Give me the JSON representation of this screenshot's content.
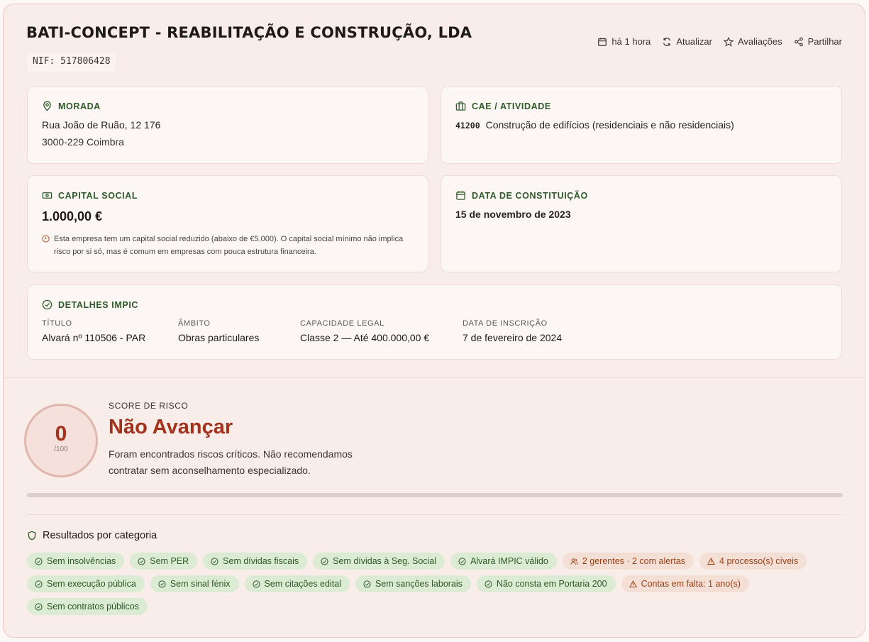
{
  "company": {
    "name": "BATI-CONCEPT - REABILITAÇÃO E CONSTRUÇÃO, LDA",
    "nif": "NIF: 517806428"
  },
  "toolbar": {
    "updated": "há 1 hora",
    "refresh": "Atualizar",
    "reviews": "Avaliações",
    "share": "Partilhar"
  },
  "address": {
    "heading": "MORADA",
    "line1": "Rua João de Ruão, 12 176",
    "line2": "3000-229 Coimbra"
  },
  "cae": {
    "heading": "CAE / ATIVIDADE",
    "code": "41200",
    "description": "Construção de edifícios (residenciais e não residenciais)"
  },
  "capital": {
    "heading": "CAPITAL SOCIAL",
    "value": "1.000,00 €",
    "note": "Esta empresa tem um capital social reduzido (abaixo de €5.000). O capital social mínimo não implica risco por si só, mas é comum em empresas com pouca estrutura financeira."
  },
  "constitution": {
    "heading": "DATA DE CONSTITUIÇÃO",
    "date": "15 de novembro de 2023"
  },
  "impic": {
    "heading": "DETALHES IMPIC",
    "fields": [
      {
        "label": "TÍTULO",
        "value": "Alvará nº 110506 - PAR"
      },
      {
        "label": "ÂMBITO",
        "value": "Obras particulares"
      },
      {
        "label": "CAPACIDADE LEGAL",
        "value": "Classe 2 — Até 400.000,00 €"
      },
      {
        "label": "DATA DE INSCRIÇÃO",
        "value": "7 de fevereiro de 2024"
      }
    ]
  },
  "risk": {
    "score": "0",
    "max": "/100",
    "progress_fraction": 0,
    "label": "SCORE DE RISCO",
    "verdict": "Não Avançar",
    "description": "Foram encontrados riscos críticos. Não recomendamos contratar sem aconselhamento especializado."
  },
  "categories": {
    "heading": "Resultados por categoria",
    "chips": [
      {
        "label": "Sem insolvências",
        "status": "ok",
        "icon": "check-circle-icon"
      },
      {
        "label": "Sem PER",
        "status": "ok",
        "icon": "check-circle-icon"
      },
      {
        "label": "Sem dívidas fiscais",
        "status": "ok",
        "icon": "check-circle-icon"
      },
      {
        "label": "Sem dívidas à Seg. Social",
        "status": "ok",
        "icon": "check-circle-icon"
      },
      {
        "label": "Alvará IMPIC válido",
        "status": "ok",
        "icon": "check-circle-icon"
      },
      {
        "label": "2 gerentes · 2 com alertas",
        "status": "warn",
        "icon": "users-icon"
      },
      {
        "label": "4 processo(s) cíveis",
        "status": "warn",
        "icon": "warning-icon"
      },
      {
        "label": "Sem execução pública",
        "status": "ok",
        "icon": "check-circle-icon"
      },
      {
        "label": "Sem sinal fénix",
        "status": "ok",
        "icon": "check-circle-icon"
      },
      {
        "label": "Sem citações edital",
        "status": "ok",
        "icon": "check-circle-icon"
      },
      {
        "label": "Sem sanções laborais",
        "status": "ok",
        "icon": "check-circle-icon"
      },
      {
        "label": "Não consta em Portaria 200",
        "status": "ok",
        "icon": "check-circle-icon"
      },
      {
        "label": "Contas em falta: 1 ano(s)",
        "status": "warn",
        "icon": "warning-icon"
      },
      {
        "label": "Sem contratos públicos",
        "status": "ok",
        "icon": "check-circle-icon"
      }
    ]
  },
  "colors": {
    "accent_green": "#2e5a2a",
    "danger": "#a2321c",
    "warning": "#9b4216"
  }
}
